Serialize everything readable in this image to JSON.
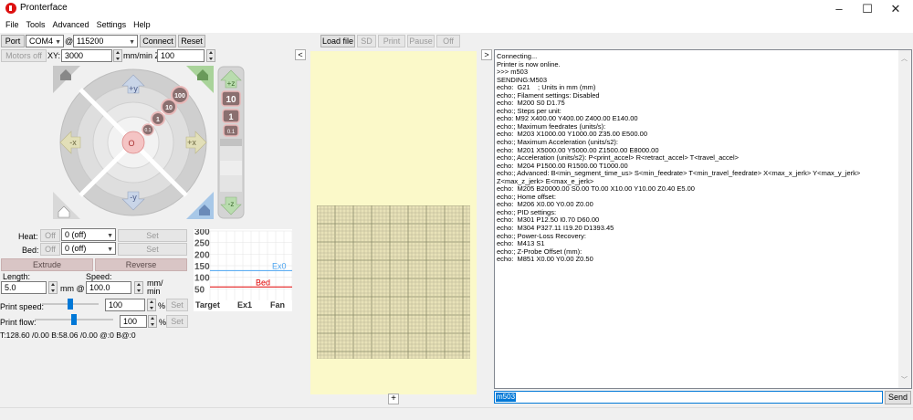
{
  "window": {
    "title": "Pronterface",
    "controls": [
      "–",
      "☐",
      "✕"
    ]
  },
  "menu": [
    "File",
    "Tools",
    "Advanced",
    "Settings",
    "Help"
  ],
  "connection": {
    "port_label": "Port",
    "port_value": "COM4",
    "at_label": "@",
    "baud_value": "115200",
    "connect_label": "Connect",
    "reset_label": "Reset"
  },
  "motion": {
    "motors_off_label": "Motors off",
    "xy_label": "XY:",
    "xy_value": "3000",
    "unit_xy": "mm/min Z:",
    "z_value": "100"
  },
  "jog": {
    "x_minus": "-x",
    "x_plus": "+x",
    "y_plus": "+y",
    "y_minus": "-y",
    "z_plus": "+z",
    "z_minus": "-z",
    "steps": [
      "100",
      "10",
      "1",
      "0.1"
    ],
    "z_steps": [
      "10",
      "1",
      "0.1"
    ],
    "center_label": "O"
  },
  "temps": {
    "heat_label": "Heat:",
    "heat_off": "Off",
    "heat_value": "0 (off)",
    "heat_set": "Set",
    "bed_label": "Bed:",
    "bed_off": "Off",
    "bed_value": "0 (off)",
    "bed_set": "Set",
    "extrude_label": "Extrude",
    "reverse_label": "Reverse",
    "length_label": "Length:",
    "length_value": "5.0",
    "mm_at": "mm @",
    "speed_label": "Speed:",
    "speed_value": "100.0",
    "speed_unit": "mm/\nmin",
    "print_speed_label": "Print speed:",
    "print_speed_value": "100",
    "print_speed_pct": "%",
    "print_speed_set": "Set",
    "print_flow_label": "Print flow:",
    "print_flow_value": "100",
    "print_flow_pct": "%",
    "print_flow_set": "Set",
    "status_line": "T:128.60 /0.00 B:58.06 /0.00 @:0 B@:0",
    "print_speed_fraction": 0.5,
    "print_flow_fraction": 0.5
  },
  "chart_data": {
    "type": "line",
    "y_ticks": [
      "300",
      "250",
      "200",
      "150",
      "100",
      "50"
    ],
    "legend": [
      "Target",
      "Ex1",
      "Fan"
    ],
    "series": [
      {
        "name": "Ex0",
        "values": [
          128.6,
          128.6,
          128.6,
          128.6
        ],
        "color": "#4aa3f0"
      },
      {
        "name": "Bed",
        "values": [
          58.06,
          58.06,
          58.06,
          58.06
        ],
        "color": "#e00000"
      }
    ],
    "ylim": [
      0,
      300
    ]
  },
  "print_controls": {
    "load_file": "Load file",
    "sd": "SD",
    "print": "Print",
    "pause": "Pause",
    "off": "Off",
    "collapse_left": "<",
    "collapse_right": ">",
    "add_button": "+"
  },
  "console": {
    "lines": "Connecting...\nPrinter is now online.\n>>> m503\nSENDING:M503\necho:  G21    ; Units in mm (mm)\necho:; Filament settings: Disabled\necho:  M200 S0 D1.75\necho:; Steps per unit:\necho: M92 X400.00 Y400.00 Z400.00 E140.00\necho:; Maximum feedrates (units/s):\necho:  M203 X1000.00 Y1000.00 Z35.00 E500.00\necho:; Maximum Acceleration (units/s2):\necho:  M201 X5000.00 Y5000.00 Z1500.00 E8000.00\necho:; Acceleration (units/s2): P<print_accel> R<retract_accel> T<travel_accel>\necho:  M204 P1500.00 R1500.00 T1000.00\necho:; Advanced: B<min_segment_time_us> S<min_feedrate> T<min_travel_feedrate> X<max_x_jerk> Y<max_y_jerk>\nZ<max_z_jerk> E<max_e_jerk>\necho:  M205 B20000.00 S0.00 T0.00 X10.00 Y10.00 Z0.40 E5.00\necho:; Home offset:\necho:  M206 X0.00 Y0.00 Z0.00\necho:; PID settings:\necho:  M301 P12.50 I0.70 D60.00\necho:  M304 P327.11 I19.20 D1393.45\necho:; Power-Loss Recovery:\necho:  M413 S1\necho:; Z-Probe Offset (mm):\necho:  M851 X0.00 Y0.00 Z0.50",
    "input_value": "m503",
    "send_label": "Send"
  }
}
